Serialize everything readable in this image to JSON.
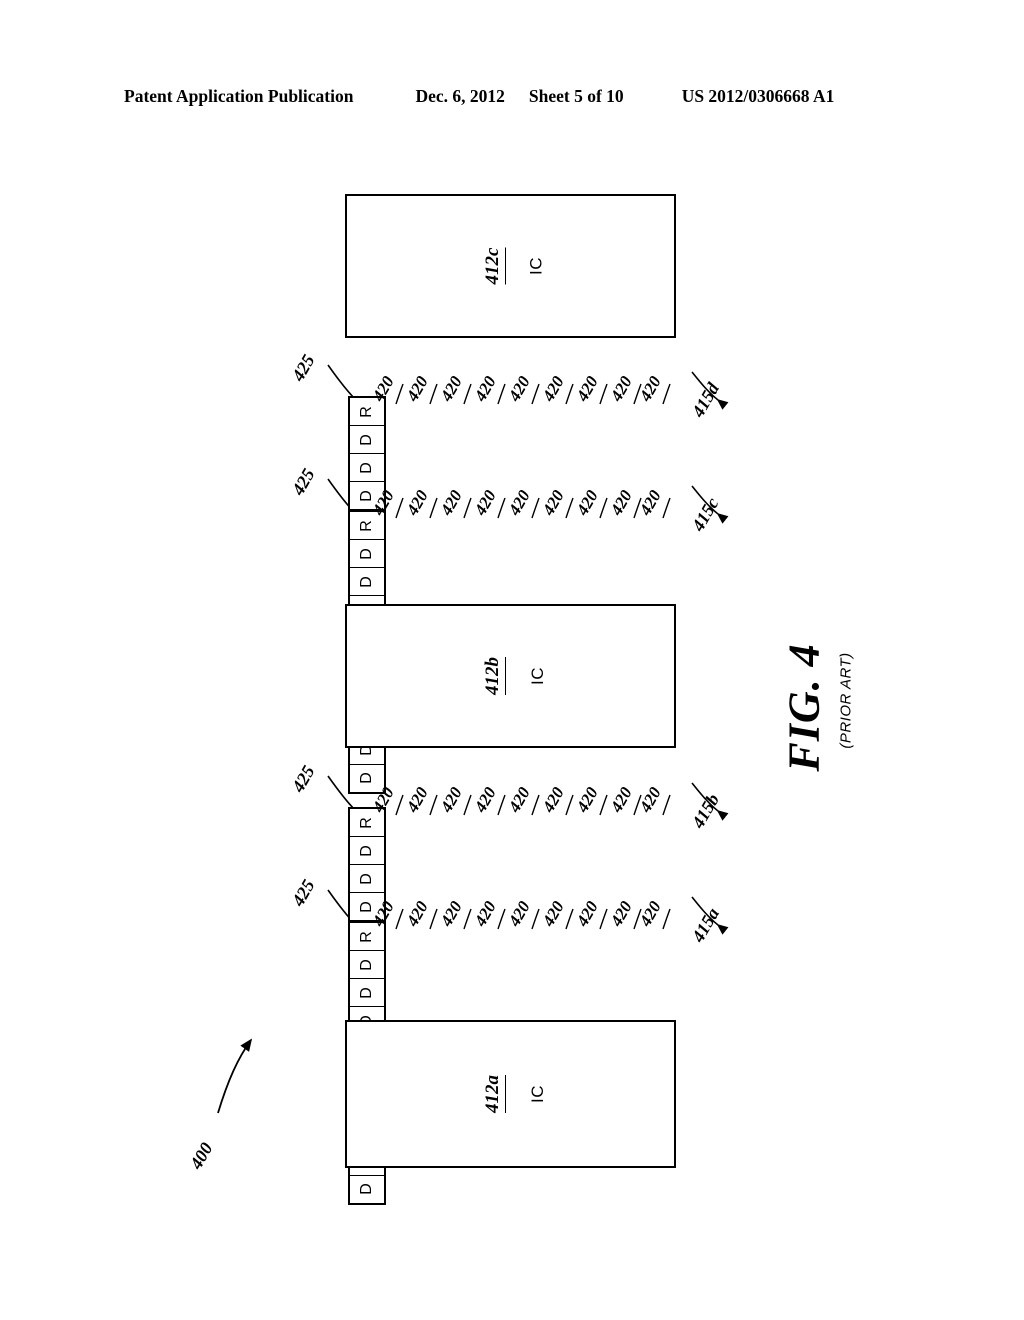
{
  "header": {
    "title": "Patent Application Publication",
    "date": "Dec. 6, 2012",
    "sheet": "Sheet 5 of 10",
    "publication_number": "US 2012/0306668 A1"
  },
  "figure": {
    "caption_number": "FIG. 4",
    "caption_subtitle": "(PRIOR ART)",
    "system_ref": "400",
    "ic_blocks": [
      {
        "label": "IC",
        "ref": "412c"
      },
      {
        "label": "IC",
        "ref": "412b"
      },
      {
        "label": "IC",
        "ref": "412a"
      }
    ],
    "modules": [
      {
        "ref": "415d",
        "register_label": "R",
        "register_ref": "425",
        "device_label": "D",
        "device_ref": "420",
        "device_count": 9
      },
      {
        "ref": "415c",
        "register_label": "R",
        "register_ref": "425",
        "device_label": "D",
        "device_ref": "420",
        "device_count": 9
      },
      {
        "ref": "415b",
        "register_label": "R",
        "register_ref": "425",
        "device_label": "D",
        "device_ref": "420",
        "device_count": 9
      },
      {
        "ref": "415a",
        "register_label": "R",
        "register_ref": "425",
        "device_label": "D",
        "device_ref": "420",
        "device_count": 9
      }
    ]
  },
  "colors": {
    "ink": "#000000",
    "paper": "#ffffff"
  }
}
